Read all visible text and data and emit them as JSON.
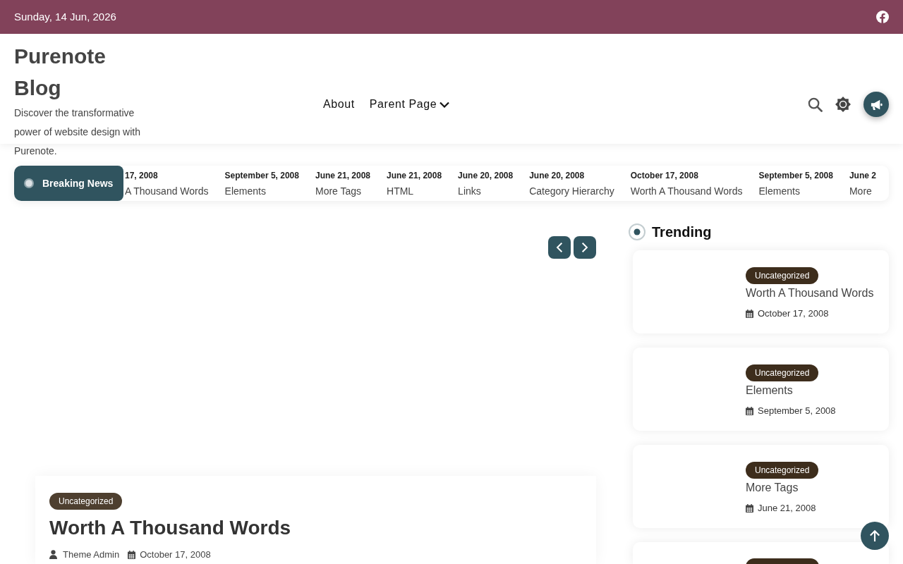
{
  "top_bar": {
    "date": "Sunday, 14 Jun, 2026"
  },
  "site": {
    "title": "Purenote Blog",
    "tagline": "Discover the transformative power of website design with Purenote."
  },
  "nav": [
    {
      "label": "About",
      "dropdown": false
    },
    {
      "label": "Parent Page",
      "dropdown": true
    }
  ],
  "ticker": {
    "label": "Breaking News",
    "items": [
      {
        "date": "17, 2008",
        "title": "A Thousand Words"
      },
      {
        "date": "September 5, 2008",
        "title": "Elements"
      },
      {
        "date": "June 21, 2008",
        "title": "More Tags"
      },
      {
        "date": "June 21, 2008",
        "title": "HTML"
      },
      {
        "date": "June 20, 2008",
        "title": "Links"
      },
      {
        "date": "June 20, 2008",
        "title": "Category Hierarchy"
      },
      {
        "date": "October 17, 2008",
        "title": "Worth A Thousand Words"
      },
      {
        "date": "September 5, 2008",
        "title": "Elements"
      },
      {
        "date": "June 2",
        "title": "More"
      }
    ]
  },
  "featured_post": {
    "category": "Uncategorized",
    "title": "Worth A Thousand Words",
    "author": "Theme Admin",
    "date": "October 17, 2008"
  },
  "trending": {
    "title": "Trending",
    "items": [
      {
        "category": "Uncategorized",
        "title": "Worth A Thousand Words",
        "date": "October 17, 2008"
      },
      {
        "category": "Uncategorized",
        "title": "Elements",
        "date": "September 5, 2008"
      },
      {
        "category": "Uncategorized",
        "title": "More Tags",
        "date": "June 21, 2008"
      }
    ]
  }
}
